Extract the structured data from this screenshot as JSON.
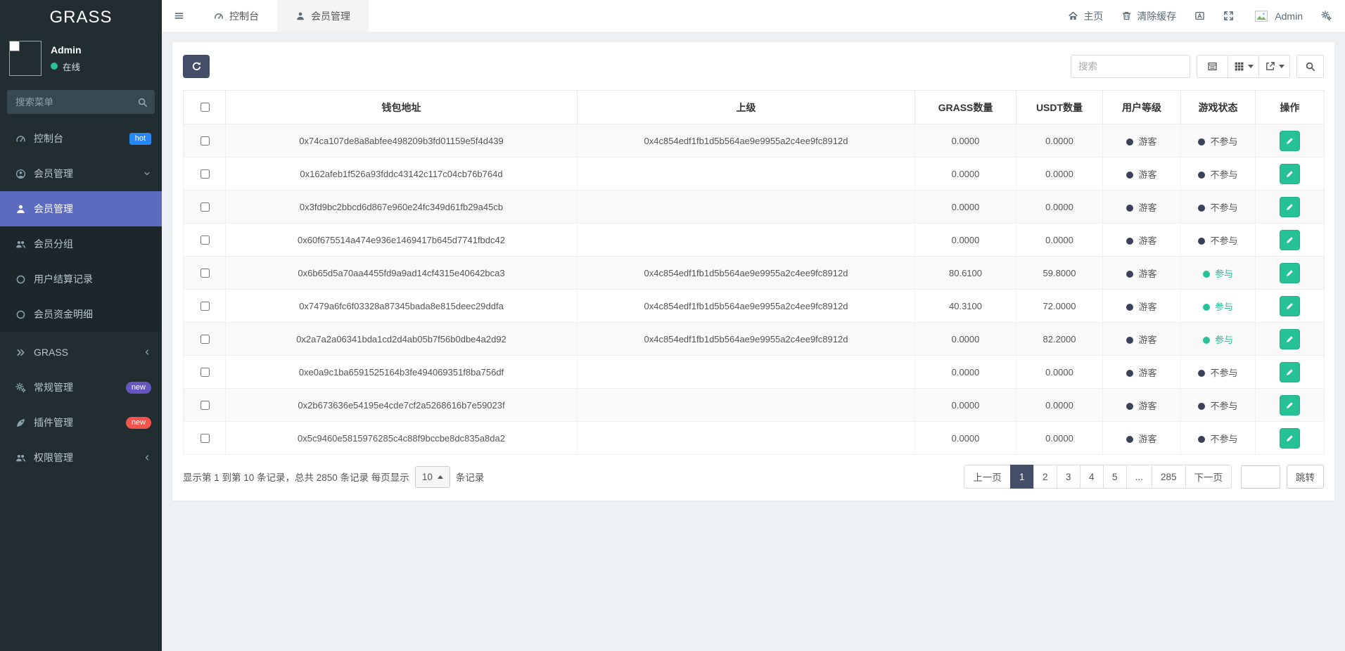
{
  "app": {
    "logo": "GRASS"
  },
  "colors": {
    "sidebar_bg": "#222d32",
    "submenu_bg": "#1c262b",
    "active_item_indigo": "#5c6bc0",
    "success_teal": "#26c196",
    "dark_slate": "#454e69",
    "badge_blue": "#2787f5",
    "badge_purple": "#6656c0",
    "badge_red": "#f4544c",
    "page_bg": "#eef1f4"
  },
  "sidebar": {
    "user_name": "Admin",
    "user_status": "在线",
    "search_placeholder": "搜索菜单",
    "menu": [
      {
        "label": "控制台",
        "icon": "dashboard-icon",
        "badge": "hot"
      },
      {
        "label": "会员管理",
        "icon": "user-circle-icon",
        "chevron": "down"
      },
      {
        "label": "会员管理",
        "icon": "user-icon",
        "active": true
      },
      {
        "label": "会员分组",
        "icon": "users-icon"
      },
      {
        "label": "用户结算记录",
        "icon": "circle-icon"
      },
      {
        "label": "会员资金明细",
        "icon": "circle-icon"
      },
      {
        "label": "GRASS",
        "icon": "angles-right-icon",
        "chevron": "left"
      },
      {
        "label": "常规管理",
        "icon": "cogs-icon",
        "badge": "new"
      },
      {
        "label": "插件管理",
        "icon": "rocket-icon",
        "badge": "new"
      },
      {
        "label": "权限管理",
        "icon": "users-icon",
        "chevron": "left"
      }
    ]
  },
  "navbar": {
    "tabs": [
      {
        "label": "控制台",
        "icon": "dashboard-icon"
      },
      {
        "label": "会员管理",
        "icon": "user-icon",
        "active": true
      }
    ],
    "home_label": "主页",
    "clear_cache_label": "清除缓存",
    "username": "Admin"
  },
  "toolbar": {
    "search_placeholder": "搜索"
  },
  "table": {
    "headers": [
      "钱包地址",
      "上级",
      "GRASS数量",
      "USDT数量",
      "用户等级",
      "游戏状态",
      "操作"
    ],
    "rows": [
      {
        "wallet": "0x74ca107de8a8abfee498209b3fd01159e5f4d439",
        "parent": "0x4c854edf1fb1d5b564ae9e9955a2c4ee9fc8912d",
        "grass": "0.0000",
        "usdt": "0.0000",
        "level": "游客",
        "status": "不参与"
      },
      {
        "wallet": "0x162afeb1f526a93fddc43142c117c04cb76b764d",
        "parent": "",
        "grass": "0.0000",
        "usdt": "0.0000",
        "level": "游客",
        "status": "不参与"
      },
      {
        "wallet": "0x3fd9bc2bbcd6d867e960e24fc349d61fb29a45cb",
        "parent": "",
        "grass": "0.0000",
        "usdt": "0.0000",
        "level": "游客",
        "status": "不参与"
      },
      {
        "wallet": "0x60f675514a474e936e1469417b645d7741fbdc42",
        "parent": "",
        "grass": "0.0000",
        "usdt": "0.0000",
        "level": "游客",
        "status": "不参与"
      },
      {
        "wallet": "0x6b65d5a70aa4455fd9a9ad14cf4315e40642bca3",
        "parent": "0x4c854edf1fb1d5b564ae9e9955a2c4ee9fc8912d",
        "grass": "80.6100",
        "usdt": "59.8000",
        "level": "游客",
        "status": "参与"
      },
      {
        "wallet": "0x7479a6fc6f03328a87345bada8e815deec29ddfa",
        "parent": "0x4c854edf1fb1d5b564ae9e9955a2c4ee9fc8912d",
        "grass": "40.3100",
        "usdt": "72.0000",
        "level": "游客",
        "status": "参与"
      },
      {
        "wallet": "0x2a7a2a06341bda1cd2d4ab05b7f56b0dbe4a2d92",
        "parent": "0x4c854edf1fb1d5b564ae9e9955a2c4ee9fc8912d",
        "grass": "0.0000",
        "usdt": "82.2000",
        "level": "游客",
        "status": "参与"
      },
      {
        "wallet": "0xe0a9c1ba6591525164b3fe494069351f8ba756df",
        "parent": "",
        "grass": "0.0000",
        "usdt": "0.0000",
        "level": "游客",
        "status": "不参与"
      },
      {
        "wallet": "0x2b673636e54195e4cde7cf2a5268616b7e59023f",
        "parent": "",
        "grass": "0.0000",
        "usdt": "0.0000",
        "level": "游客",
        "status": "不参与"
      },
      {
        "wallet": "0x5c9460e5815976285c4c88f9bccbe8dc835a8da2",
        "parent": "",
        "grass": "0.0000",
        "usdt": "0.0000",
        "level": "游客",
        "status": "不参与"
      }
    ]
  },
  "footer": {
    "summary_prefix": "显示第 1 到第 10 条记录，总共 2850 条记录 每页显示",
    "page_size": "10",
    "summary_suffix": "条记录",
    "pagination": {
      "prev": "上一页",
      "pages": [
        "1",
        "2",
        "3",
        "4",
        "5",
        "...",
        "285"
      ],
      "active_page": "1",
      "next": "下一页",
      "jump": "跳转"
    }
  }
}
